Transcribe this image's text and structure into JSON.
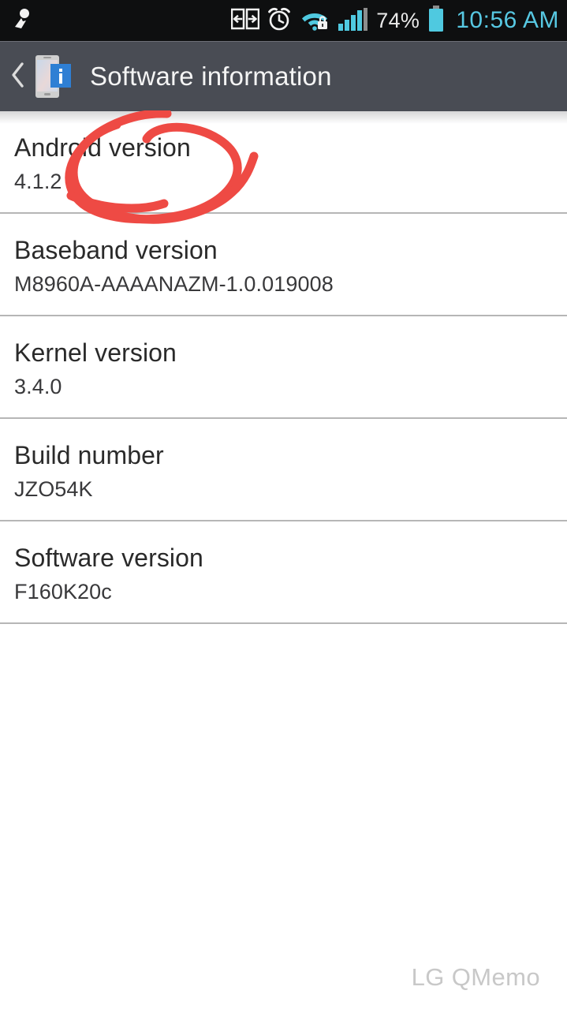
{
  "status_bar": {
    "notification_icon": "notification-person-icon",
    "icons": [
      {
        "name": "data-transfer-icon",
        "label": "Data transfer"
      },
      {
        "name": "alarm-clock-icon",
        "label": "Alarm"
      },
      {
        "name": "wifi-secured-icon",
        "label": "Wi-Fi secured"
      },
      {
        "name": "signal-bars-icon",
        "label": "Signal"
      }
    ],
    "battery_percent": "74%",
    "battery_icon": "battery-icon",
    "clock": "10:56 AM",
    "clock_color": "#57c8e2",
    "background_color": "#0e0f10"
  },
  "header": {
    "back_label": "Back",
    "back_icon": "chevron-left-icon",
    "app_icon": "device-info-icon",
    "title": "Software information",
    "background_color": "#494c54"
  },
  "list": {
    "rows": [
      {
        "title": "Android version",
        "value": "4.1.2"
      },
      {
        "title": "Baseband version",
        "value": "M8960A-AAAANAZM-1.0.019008"
      },
      {
        "title": "Kernel version",
        "value": "3.4.0"
      },
      {
        "title": "Build number",
        "value": "JZO54K"
      },
      {
        "title": "Software version",
        "value": "F160K20c"
      }
    ]
  },
  "annotation": {
    "type": "hand-drawn-circle",
    "target": "Android version",
    "color": "#ee4a44"
  },
  "watermark": {
    "text": "LG QMemo",
    "color": "#c8c8c8"
  }
}
